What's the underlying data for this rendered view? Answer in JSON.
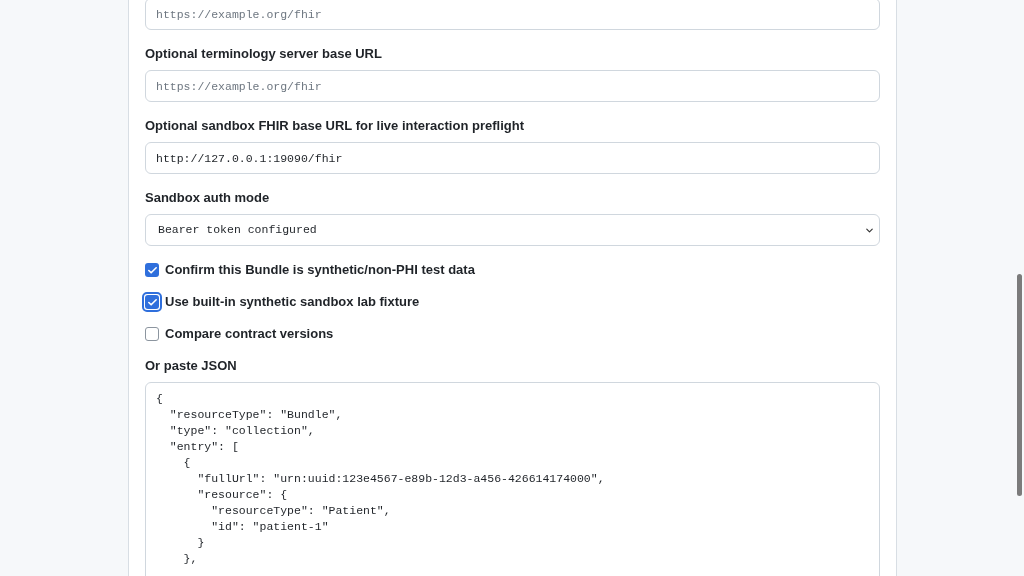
{
  "fields": [
    {
      "kind": "input",
      "placeholder": "https://example.org/fhir"
    },
    {
      "kind": "input",
      "label": "Optional terminology server base URL",
      "placeholder": "https://example.org/fhir"
    },
    {
      "kind": "input",
      "label": "Optional sandbox FHIR base URL for live interaction preflight",
      "value": "http://127.0.0.1:19090/fhir"
    },
    {
      "kind": "select",
      "label": "Sandbox auth mode",
      "value": "Bearer token configured"
    },
    {
      "kind": "checkbox",
      "label": "Confirm this Bundle is synthetic/non-PHI test data",
      "checked": true,
      "focused": false
    },
    {
      "kind": "checkbox",
      "label": "Use built-in synthetic sandbox lab fixture",
      "checked": true,
      "focused": true
    },
    {
      "kind": "checkbox",
      "label": "Compare contract versions",
      "checked": false,
      "focused": false
    },
    {
      "kind": "textarea",
      "label": "Or paste JSON",
      "lines": [
        "{",
        "  \"resourceType\": \"Bundle\",",
        "  \"type\": \"collection\",",
        "  \"entry\": [",
        "    {",
        "      \"fullUrl\": \"urn:uuid:123e4567-e89b-12d3-a456-426614174000\",",
        "      \"resource\": {",
        "        \"resourceType\": \"Patient\",",
        "        \"id\": \"patient-1\"",
        "      }",
        "    },"
      ]
    }
  ]
}
